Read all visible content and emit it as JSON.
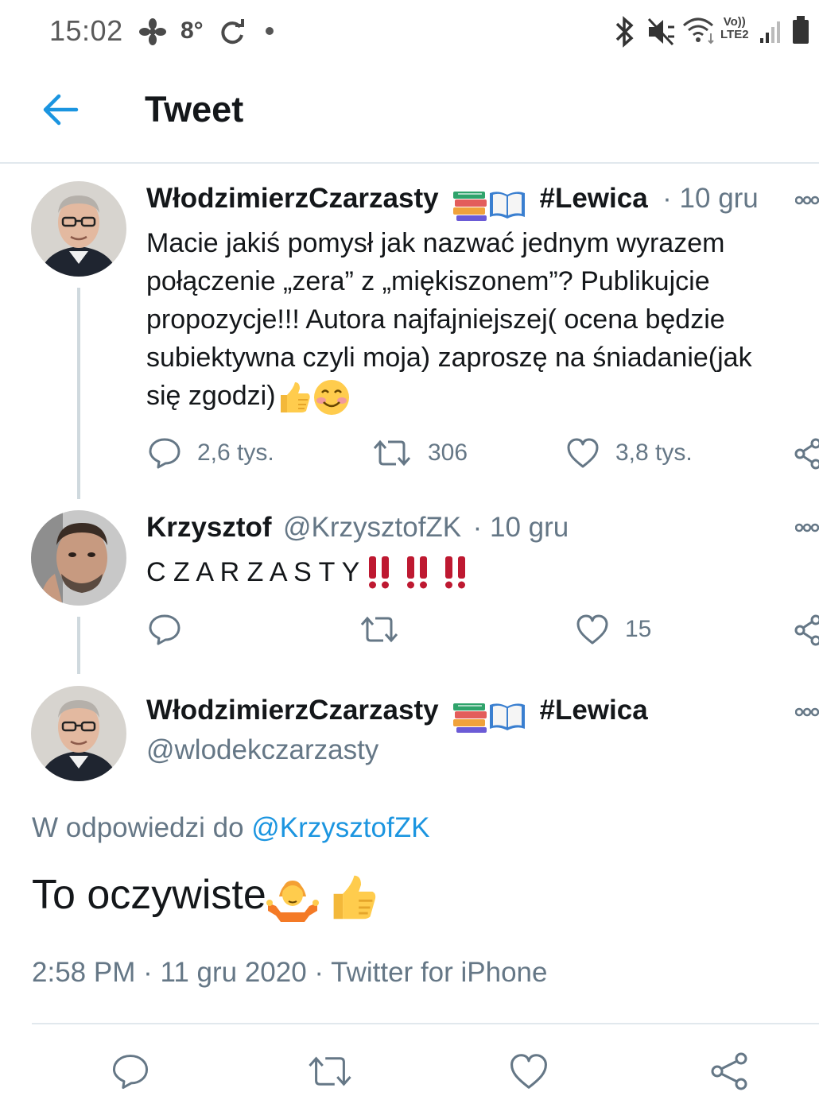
{
  "status_bar": {
    "time": "15:02",
    "temperature": "8°",
    "network_top": "Vo))",
    "network_bottom": "LTE2"
  },
  "header": {
    "title": "Tweet"
  },
  "tweets": [
    {
      "name": "WłodzimierzCzarzasty",
      "tag": "#Lewica",
      "date": "· 10 gru",
      "lines": [
        "Macie jakiś pomysł jak nazwać  jednym wyrazem",
        "połączenie „zera” z „miękiszonem”? Publikujcie",
        "propozycje!!! Autora najfajniejszej( ocena będzie",
        "subiektywna czyli moja) zaproszę na śniadanie(jak",
        "się zgodzi)"
      ],
      "replies": "2,6 tys.",
      "retweets": "306",
      "likes": "3,8 tys."
    },
    {
      "name": "Krzysztof",
      "handle": "@KrzysztofZK",
      "date": "· 10 gru",
      "text": "C Z A R Z A S T Y",
      "likes": "15"
    }
  ],
  "main_tweet": {
    "name": "WłodzimierzCzarzasty",
    "tag": "#Lewica",
    "handle": "@wlodekczarzasty",
    "reply_prefix": "W odpowiedzi do",
    "reply_handle": "@KrzysztofZK",
    "text": "To oczywiste",
    "timestamp": "2:58 PM · 11 gru 2020 · Twitter for iPhone"
  },
  "colors": {
    "accent": "#1b95e0",
    "muted": "#657786",
    "text": "#14171a",
    "divider": "#e1e8ed",
    "exclaim": "#be1931"
  }
}
